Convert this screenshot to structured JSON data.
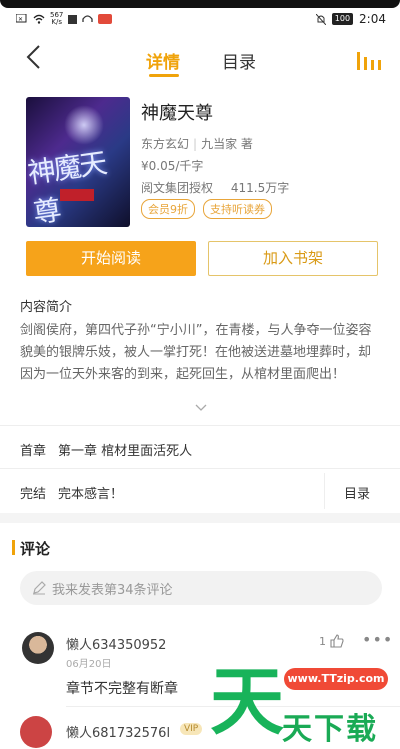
{
  "status_bar": {
    "speed_value": "567",
    "speed_unit": "K/s",
    "battery": "100",
    "time": "2:04"
  },
  "nav": {
    "tab_detail": "详情",
    "tab_catalog": "目录"
  },
  "book": {
    "title": "神魔天尊",
    "genre": "东方玄幻",
    "author": "九当家 著",
    "price": "¥0.05/千字",
    "publisher": "阅文集团授权",
    "word_count": "411.5万字",
    "tags": [
      "会员9折",
      "支持听读券"
    ]
  },
  "actions": {
    "read": "开始阅读",
    "add_shelf": "加入书架"
  },
  "intro": {
    "heading": "内容简介",
    "text": "剑阁侯府，第四代子孙“宁小川”，在青楼，与人争夺一位姿容貌美的银牌乐妓，被人一掌打死！在他被送进墓地埋葬时，却因为一位天外来客的到来，起死回生，从棺材里面爬出！"
  },
  "chapter": {
    "label": "首章",
    "name": "第一章 棺材里面活死人"
  },
  "status": {
    "label": "完结",
    "value": "完本感言！",
    "catalog_link": "目录"
  },
  "comments": {
    "heading": "评论",
    "input_placeholder": "我来发表第34条评论",
    "items": [
      {
        "user": "懒人634350952",
        "date": "06月20日",
        "likes": "1",
        "text": "章节不完整有断章"
      },
      {
        "user": "懒人681732576l",
        "badge": "VIP"
      }
    ]
  },
  "watermark": {
    "url": "www.TTzip.com",
    "big": "天",
    "small": "天下载"
  },
  "colors": {
    "accent": "#f0a30a",
    "read_button": "#f6a31a"
  }
}
